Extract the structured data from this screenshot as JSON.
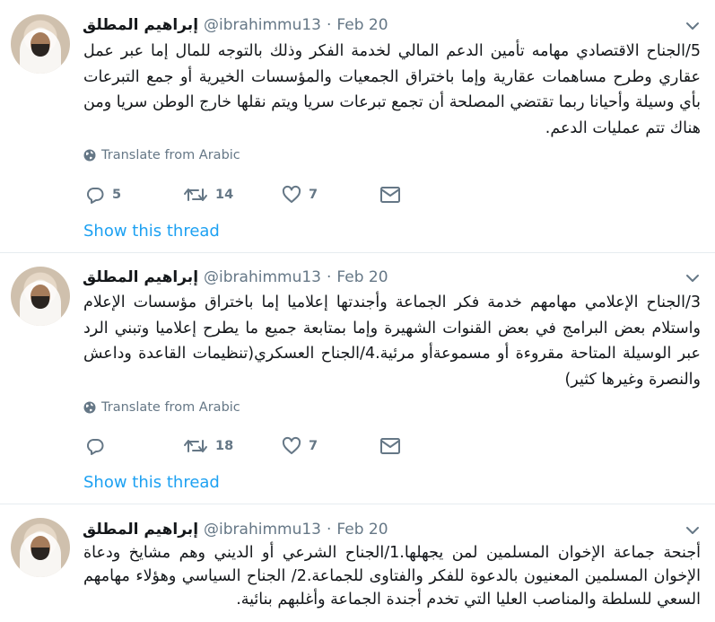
{
  "tweets": [
    {
      "name": "إبراهيم المطلق",
      "handle": "@ibrahimmu13",
      "sep": "·",
      "date": "Feb 20",
      "text": "5/الجناح الاقتصادي مهامه تأمين الدعم المالي لخدمة الفكر وذلك بالتوجه للمال إما عبر عمل عقاري وطرح مساهمات عقارية وإما باختراق الجمعيات والمؤسسات الخيرية أو جمع التبرعات بأي وسيلة وأحيانا ربما تقتضي المصلحة أن تجمع تبرعات سريا ويتم نقلها خارج الوطن سريا ومن هناك تتم عمليات الدعم.",
      "translate": "Translate from Arabic",
      "replies": "5",
      "retweets": "14",
      "likes": "7",
      "show_thread": "Show this thread"
    },
    {
      "name": "إبراهيم المطلق",
      "handle": "@ibrahimmu13",
      "sep": "·",
      "date": "Feb 20",
      "text": "3/الجناح الإعلامي مهامهم خدمة فكر الجماعة وأجندتها إعلاميا إما باختراق مؤسسات الإعلام واستلام بعض البرامج في بعض القنوات الشهيرة وإما بمتابعة جميع ما يطرح إعلاميا وتبني الرد عبر الوسيلة المتاحة مقروءة أو مسموعةأو مرئية.4/الجناح العسكري(تنظيمات القاعدة وداعش والنصرة وغيرها كثير)",
      "translate": "Translate from Arabic",
      "replies": "",
      "retweets": "18",
      "likes": "7",
      "show_thread": "Show this thread"
    },
    {
      "name": "إبراهيم المطلق",
      "handle": "@ibrahimmu13",
      "sep": "·",
      "date": "Feb 20",
      "text": "أجنحة جماعة الإخوان المسلمين لمن يجهلها.1/الجناح الشرعي أو الديني وهم مشايخ ودعاة الإخوان المسلمين المعنيون بالدعوة للفكر والفتاوى للجماعة.2/ الجناح السياسي وهؤلاء مهامهم السعي للسلطة والمناصب العليا التي تخدم أجندة الجماعة وأغلبهم بنائية."
    }
  ],
  "icons": {
    "caret": "chevron-down-icon",
    "globe": "globe-icon",
    "reply": "reply-icon",
    "retweet": "retweet-icon",
    "like": "heart-icon",
    "dm": "envelope-icon"
  },
  "colors": {
    "accent": "#1da1f2",
    "muted": "#657786",
    "text": "#14171a",
    "divider": "#e6ecf0"
  }
}
